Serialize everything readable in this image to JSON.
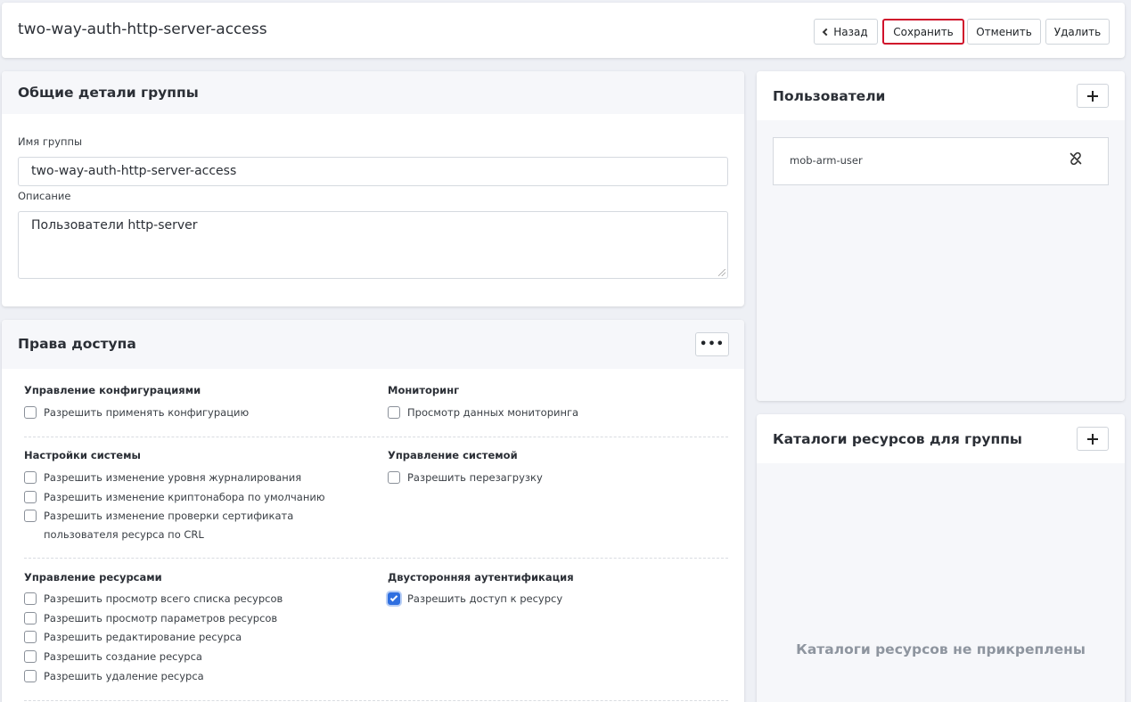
{
  "header": {
    "title": "two-way-auth-http-server-access",
    "back_label": "Назад",
    "save_label": "Сохранить",
    "cancel_label": "Отменить",
    "delete_label": "Удалить"
  },
  "general": {
    "title": "Общие детали группы",
    "name_label": "Имя группы",
    "name_value": "two-way-auth-http-server-access",
    "description_label": "Описание",
    "description_value": "Пользователи http-server"
  },
  "rights": {
    "title": "Права доступа",
    "more_label": "•••",
    "groups": [
      {
        "title": "Управление конфигурациями",
        "items": [
          {
            "label": "Разрешить применять конфигурацию",
            "checked": false
          }
        ]
      },
      {
        "title": "Мониторинг",
        "items": [
          {
            "label": "Просмотр данных мониторинга",
            "checked": false
          }
        ]
      },
      {
        "title": "Настройки системы",
        "items": [
          {
            "label": "Разрешить изменение уровня журналирования",
            "checked": false
          },
          {
            "label": "Разрешить изменение криптонабора по умолчанию",
            "checked": false
          },
          {
            "label": "Разрешить изменение проверки сертификата пользователя ресурса по CRL",
            "checked": false
          }
        ]
      },
      {
        "title": "Управление системой",
        "items": [
          {
            "label": "Разрешить перезагрузку",
            "checked": false
          }
        ]
      },
      {
        "title": "Управление ресурсами",
        "items": [
          {
            "label": "Разрешить просмотр всего списка ресурсов",
            "checked": false
          },
          {
            "label": "Разрешить просмотр параметров ресурсов",
            "checked": false
          },
          {
            "label": "Разрешить редактирование ресурса",
            "checked": false
          },
          {
            "label": "Разрешить создание ресурса",
            "checked": false
          },
          {
            "label": "Разрешить удаление ресурса",
            "checked": false
          }
        ]
      },
      {
        "title": "Двусторонняя аутентификация",
        "items": [
          {
            "label": "Разрешить доступ к ресурсу",
            "checked": true
          }
        ]
      }
    ]
  },
  "users": {
    "title": "Пользователи",
    "items": [
      {
        "name": "mob-arm-user"
      }
    ]
  },
  "catalogs": {
    "title": "Каталоги ресурсов для группы",
    "empty_text": "Каталоги ресурсов не прикреплены"
  },
  "colors": {
    "accent": "#2f6fe0",
    "save_border": "#d0112b"
  },
  "icons": {
    "back": "chevron-left-icon",
    "add": "plus-icon",
    "unlink": "unlink-icon",
    "more": "more-icon"
  }
}
